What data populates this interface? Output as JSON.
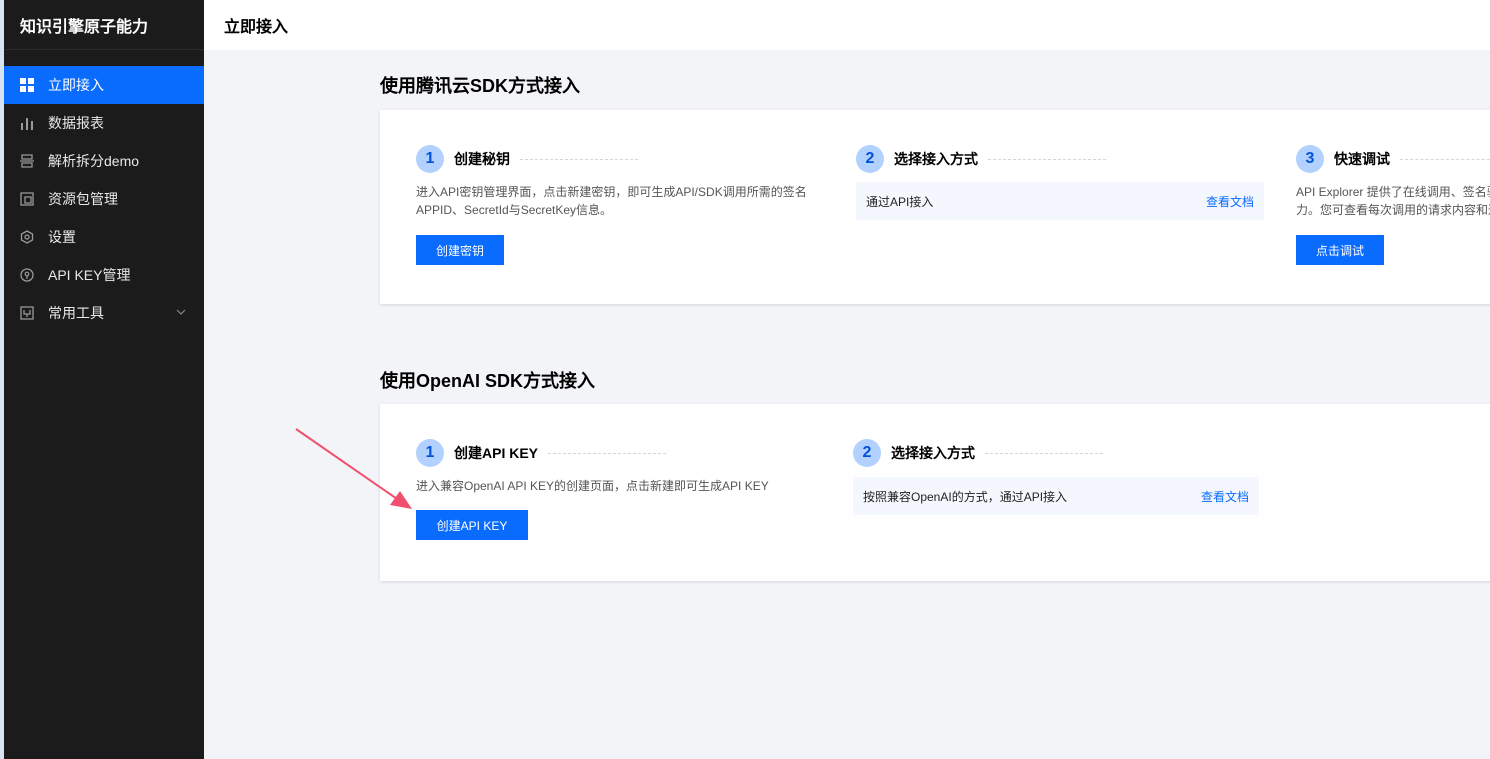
{
  "sidebar": {
    "brand": "知识引擎原子能力",
    "items": [
      {
        "label": "立即接入",
        "icon": "grid-icon"
      },
      {
        "label": "数据报表",
        "icon": "bar-chart-icon"
      },
      {
        "label": "解析拆分demo",
        "icon": "split-icon"
      },
      {
        "label": "资源包管理",
        "icon": "package-icon"
      },
      {
        "label": "设置",
        "icon": "settings-icon"
      },
      {
        "label": "API KEY管理",
        "icon": "key-icon"
      },
      {
        "label": "常用工具",
        "icon": "tools-icon"
      }
    ]
  },
  "topbar": {
    "title": "立即接入"
  },
  "section1": {
    "title": "使用腾讯云SDK方式接入",
    "step1": {
      "num": "1",
      "title": "创建秘钥",
      "desc_line1": "进入API密钥管理界面，点击新建密钥，即可生成API/SDK调用所需的签名",
      "desc_line2": "APPID、SecretId与SecretKey信息。",
      "button": "创建密钥"
    },
    "step2": {
      "num": "2",
      "title": "选择接入方式",
      "option": "通过API接入",
      "link": "查看文档"
    },
    "step3": {
      "num": "3",
      "title": "快速调试",
      "desc_line1": "API Explorer 提供了在线调用、签名验",
      "desc_line2": "力。您可查看每次调用的请求内容和返",
      "button": "点击调试"
    }
  },
  "section2": {
    "title": "使用OpenAI SDK方式接入",
    "step1": {
      "num": "1",
      "title": "创建API KEY",
      "desc": "进入兼容OpenAI API KEY的创建页面，点击新建即可生成API KEY",
      "button": "创建API KEY"
    },
    "step2": {
      "num": "2",
      "title": "选择接入方式",
      "option": "按照兼容OpenAI的方式，通过API接入",
      "link": "查看文档"
    }
  },
  "colors": {
    "accent": "#0a6cff",
    "sidebar_bg": "#1b1b1b",
    "arrow": "#f0506e"
  }
}
